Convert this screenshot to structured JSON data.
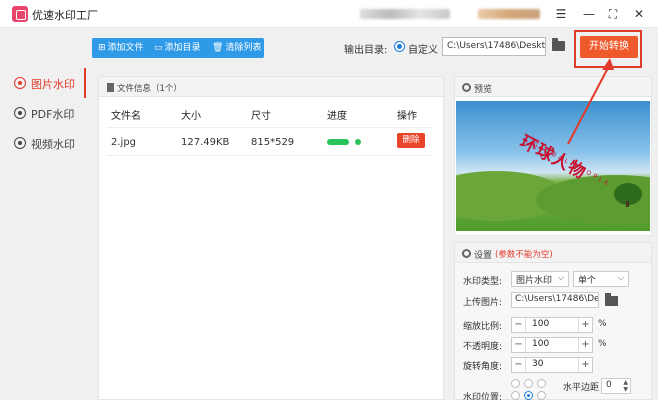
{
  "window": {
    "title": "优速水印工厂",
    "controls": {
      "menu": "☰",
      "minimize": "—",
      "maximize": "⛶",
      "close": "✕"
    }
  },
  "toolbar": {
    "add_file": "添加文件",
    "add_folder": "添加目录",
    "clear_list": "清除列表",
    "output_label": "输出目录:",
    "custom_option": "自定义",
    "output_path": "C:\\Users\\17486\\Deskto",
    "start_button": "开始转换"
  },
  "sidebar": {
    "items": [
      {
        "label": "图片水印",
        "active": true
      },
      {
        "label": "PDF水印",
        "active": false
      },
      {
        "label": "视频水印",
        "active": false
      }
    ]
  },
  "file_panel": {
    "title": "文件信息（1个）",
    "columns": [
      "文件名",
      "大小",
      "尺寸",
      "进度",
      "操作"
    ],
    "rows": [
      {
        "name": "2.jpg",
        "size": "127.49KB",
        "dimensions": "815*529",
        "delete_label": "删除"
      }
    ]
  },
  "preview": {
    "title": "预览",
    "watermark_text": "环球人物",
    "watermark_sub": "GLOBAL PEOPLE"
  },
  "settings": {
    "title": "设置",
    "note": "(参数不能为空)",
    "watermark_type_label": "水印类型:",
    "watermark_type_value": "图片水印",
    "watermark_mode_value": "单个",
    "upload_label": "上传图片:",
    "upload_path": "C:\\Users\\17486\\Des",
    "scale_label": "缩放比例:",
    "scale_value": "100",
    "opacity_label": "不透明度:",
    "opacity_value": "100",
    "rotation_label": "旋转角度:",
    "rotation_value": "30",
    "position_label": "水印位置:",
    "hmargin_label": "水平边距",
    "hmargin_value": "0",
    "percent": "%"
  },
  "colors": {
    "accent_red": "#e23a2a",
    "toolbar_blue": "#2f9be8",
    "start_orange": "#ef5a2c",
    "progress_green": "#28c35a"
  }
}
